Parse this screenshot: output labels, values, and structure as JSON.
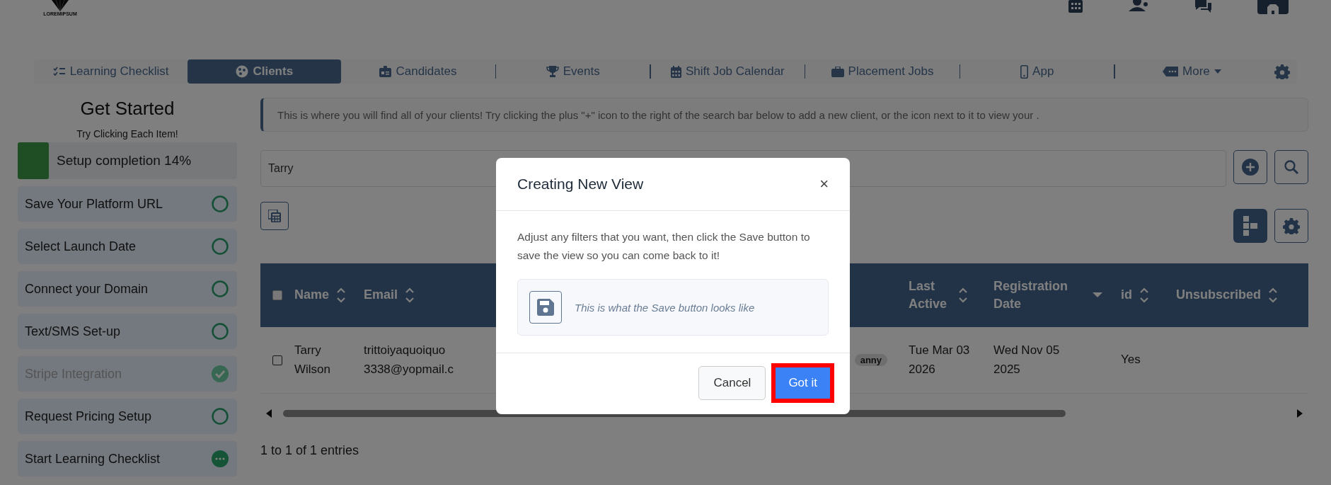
{
  "header": {
    "logo_text": "LOREMIPSUM"
  },
  "nav": {
    "tabs": [
      {
        "label": "Learning Checklist",
        "selected": false
      },
      {
        "label": "Clients",
        "selected": true
      },
      {
        "label": "Candidates",
        "selected": false
      },
      {
        "label": "Events",
        "selected": false
      },
      {
        "label": "Shift Job Calendar",
        "selected": false
      },
      {
        "label": "Placement Jobs",
        "selected": false
      },
      {
        "label": "App",
        "selected": false
      },
      {
        "label": "More",
        "selected": false
      }
    ]
  },
  "sidebar": {
    "title": "Get Started",
    "subtitle": "Try Clicking Each Item!",
    "progress": {
      "label": "Setup completion 14%",
      "level": 0.14
    },
    "items": [
      {
        "label": "Save Your Platform URL",
        "done": false,
        "in_progress": false
      },
      {
        "label": "Select Launch Date",
        "done": false,
        "in_progress": false
      },
      {
        "label": "Connect your Domain",
        "done": false,
        "in_progress": false
      },
      {
        "label": "Text/SMS Set-up",
        "done": false,
        "in_progress": false
      },
      {
        "label": "Stripe Integration",
        "done": true,
        "in_progress": false
      },
      {
        "label": "Request Pricing Setup",
        "done": false,
        "in_progress": false
      },
      {
        "label": "Start Learning Checklist",
        "done": false,
        "in_progress": true
      }
    ]
  },
  "info_banner": "This is where you will find all of your clients! Try clicking the plus \"+\" icon to the right of the search bar below to add a new client, or the icon next to it to view your .",
  "search": {
    "value": "Tarry"
  },
  "table": {
    "select_all_checked": false,
    "columns": [
      {
        "label": "Name",
        "sorted": false
      },
      {
        "label": "Email",
        "sorted": false
      },
      {
        "label": "Last Active",
        "sorted": false
      },
      {
        "label": "Registration Date",
        "sorted": true
      },
      {
        "label": "id",
        "sorted": false
      },
      {
        "label": "Unsubscribed",
        "sorted": false
      }
    ],
    "rows": [
      {
        "checked": false,
        "name": "Tarry Wilson",
        "email": [
          "trittoiyaquoiquo",
          "3338@yopmail.c"
        ],
        "tag": "anny",
        "last_active": "Tue Mar 03 2026",
        "registration_date": "Wed Nov 05 2025",
        "id": "Yes"
      }
    ]
  },
  "entries_info": "1 to 1 of 1 entries",
  "modal": {
    "title": "Creating New View",
    "close": "×",
    "body": "Adjust any filters that you want, then click the Save button to save the view so you can come back to it!",
    "example": "This is what the Save button looks like",
    "buttons": [
      {
        "label": "Cancel",
        "kind": "secondary"
      },
      {
        "label": "Got it",
        "kind": "primary",
        "highlighted": true
      }
    ]
  }
}
